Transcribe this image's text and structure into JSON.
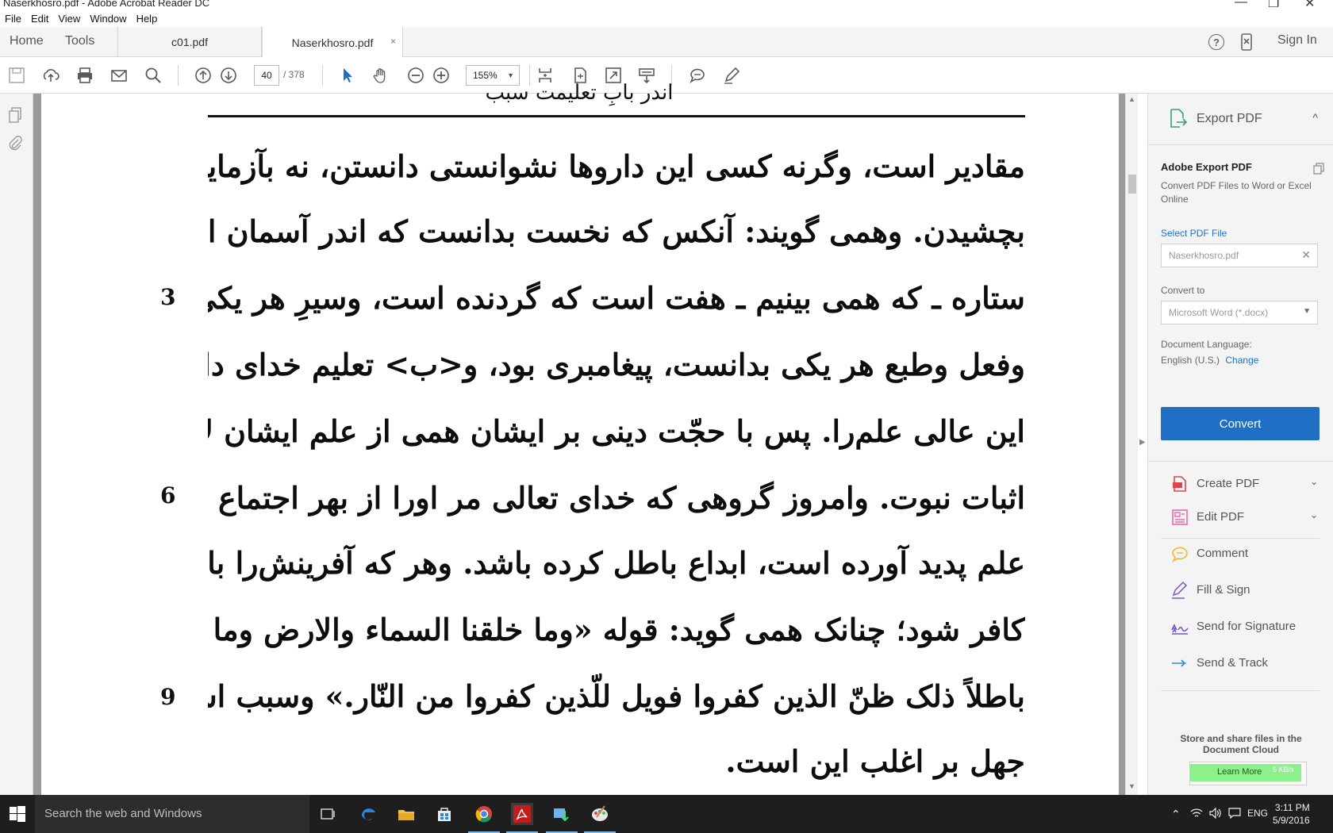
{
  "window": {
    "title": "Naserkhosro.pdf - Adobe Acrobat Reader DC",
    "min": "—",
    "max": "❐",
    "close": "✕"
  },
  "menu": [
    "File",
    "Edit",
    "View",
    "Window",
    "Help"
  ],
  "tabs": {
    "home": "Home",
    "tools": "Tools",
    "doc1": "c01.pdf",
    "doc2": "Naserkhosro.pdf",
    "close": "×",
    "help": "?",
    "signin": "Sign In"
  },
  "toolbar": {
    "page_current": "40",
    "page_total": "/ 378",
    "zoom": "155%",
    "caret": "▼"
  },
  "document": {
    "header_fragment": "اندر بابِ تعلیمت سبب",
    "lines": [
      "مقادیر است، وگرنه کسی این داروها نشوانستی دانستن، نه بآزمایش ونه",
      "بچشیدن. وهمی گویند: آنکس که نخست بدانست که اندر آسمان از چندین هزار",
      "ستاره ـ که همی بینیم ـ هفت است که گردنده است، وسیرِ هر یکی بشناخت،",
      "وفعل وطبع هر یکی بدانست، پیغامبری بود، و<ب> تعلیم خدای دانست",
      "این عالی علم‌را. پس با حجّت دینی بر ایشان همی از علم ایشان لازم آید",
      "اثبات نبوت. وامروز گروهی که خدای تعالی مر اورا از بهر اجتماع بر گردِ",
      "علم پدید آورده است، ابداع باطل کرده باشد. وهر که آفرینش‌را باطل کند",
      "کافر شود؛ چنانک همی گوید: قوله «وما خلقنا السماء والارض وما بینهما",
      "باطلاً ذلک ظنّ الذین کفروا فویل للّذین کفروا من النّار.» وسبب استیلاء",
      "جهل بر اغلب این است."
    ],
    "line_numbers": {
      "l3": "3",
      "l6": "6",
      "l9": "9"
    }
  },
  "panel": {
    "export_header": "Export PDF",
    "chevron_up": "^",
    "export_title": "Adobe Export PDF",
    "export_desc": "Convert PDF Files to Word or Excel Online",
    "select_file": "Select PDF File",
    "file_value": "Naserkhosro.pdf",
    "clear": "✕",
    "convert_to_label": "Convert to",
    "convert_to_value": "Microsoft Word (*.docx)",
    "caret": "▼",
    "doc_lang_label": "Document Language:",
    "doc_lang_value": "English (U.S.)",
    "change": "Change",
    "convert_btn": "Convert",
    "tools": [
      {
        "label": "Create PDF",
        "chev": "⌄",
        "color": "#e0474c"
      },
      {
        "label": "Edit PDF",
        "chev": "⌄",
        "color": "#e86aa8"
      },
      {
        "label": "Comment",
        "color": "#f2b733"
      },
      {
        "label": "Fill & Sign",
        "color": "#8264c9"
      },
      {
        "label": "Send for Signature",
        "color": "#7a55c4"
      },
      {
        "label": "Send & Track",
        "color": "#2c8fd6"
      }
    ],
    "cloud_text": "Store and share files in the Document Cloud",
    "learn_more": "Learn More",
    "speed": "5 KB/s"
  },
  "taskbar": {
    "search_placeholder": "Search the web and Windows",
    "lang": "ENG",
    "time": "3:11 PM",
    "date": "5/9/2016"
  },
  "colors": {
    "accent": "#1f6fc5",
    "taskbar": "#1e1e1e",
    "learn_green": "#8cf08c"
  }
}
